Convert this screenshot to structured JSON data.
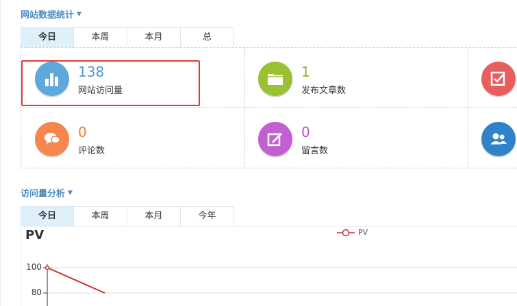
{
  "site_stats": {
    "title": "网站数据统计",
    "tabs": [
      {
        "label": "今日",
        "active": true
      },
      {
        "label": "本周",
        "active": false
      },
      {
        "label": "本月",
        "active": false
      },
      {
        "label": "总",
        "active": false
      }
    ],
    "cards": [
      {
        "value": "138",
        "label": "网站访问量",
        "color": "#5fa8dc",
        "icon": "bar-chart-icon"
      },
      {
        "value": "1",
        "label": "发布文章数",
        "color": "#9ac132",
        "icon": "folder-icon"
      },
      {
        "value": "",
        "label": "",
        "color": "#e95d5d",
        "icon": "checkbox-icon"
      },
      {
        "value": "0",
        "label": "评论数",
        "color": "#f7864d",
        "icon": "chat-bubbles-icon"
      },
      {
        "value": "0",
        "label": "留言数",
        "color": "#c45fd3",
        "icon": "edit-note-icon"
      },
      {
        "value": "",
        "label": "",
        "color": "#2f82c9",
        "icon": "users-icon"
      }
    ]
  },
  "visit_analysis": {
    "title": "访问量分析",
    "tabs": [
      {
        "label": "今日",
        "active": true
      },
      {
        "label": "本周",
        "active": false
      },
      {
        "label": "本月",
        "active": false
      },
      {
        "label": "今年",
        "active": false
      }
    ]
  },
  "chart_data": {
    "type": "line",
    "title": "PV",
    "series": [
      {
        "name": "PV",
        "color": "#c23531",
        "values": [
          100,
          80
        ]
      }
    ],
    "yticks": [
      "100",
      "80"
    ],
    "grid": true,
    "legend": "top-center"
  }
}
